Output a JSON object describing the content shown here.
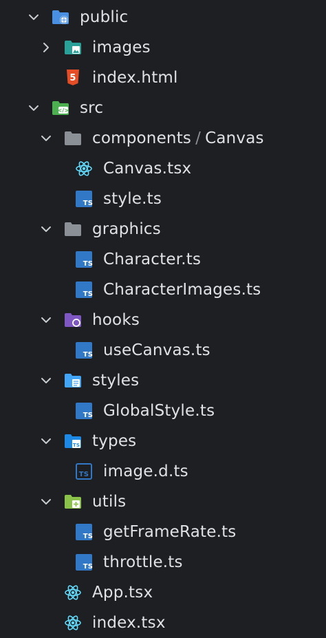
{
  "tree": [
    {
      "label": "public",
      "depth": 0,
      "expanded": true,
      "icon": "folder-public-icon"
    },
    {
      "label": "images",
      "depth": 1,
      "expanded": false,
      "icon": "folder-images-icon"
    },
    {
      "label": "index.html",
      "depth": 1,
      "icon": "html5-icon"
    },
    {
      "label": "src",
      "depth": 0,
      "expanded": true,
      "icon": "folder-src-icon"
    },
    {
      "label": "components",
      "label2": "Canvas",
      "separator": "/",
      "depth": 1,
      "expanded": true,
      "icon": "folder-icon"
    },
    {
      "label": "Canvas.tsx",
      "depth": 2,
      "icon": "react-icon"
    },
    {
      "label": "style.ts",
      "depth": 2,
      "icon": "typescript-icon"
    },
    {
      "label": "graphics",
      "depth": 1,
      "expanded": true,
      "icon": "folder-icon"
    },
    {
      "label": "Character.ts",
      "depth": 2,
      "icon": "typescript-icon"
    },
    {
      "label": "CharacterImages.ts",
      "depth": 2,
      "icon": "typescript-icon"
    },
    {
      "label": "hooks",
      "depth": 1,
      "expanded": true,
      "icon": "folder-hooks-icon"
    },
    {
      "label": "useCanvas.ts",
      "depth": 2,
      "icon": "typescript-icon"
    },
    {
      "label": "styles",
      "depth": 1,
      "expanded": true,
      "icon": "folder-styles-icon"
    },
    {
      "label": "GlobalStyle.ts",
      "depth": 2,
      "icon": "typescript-icon"
    },
    {
      "label": "types",
      "depth": 1,
      "expanded": true,
      "icon": "folder-types-icon"
    },
    {
      "label": "image.d.ts",
      "depth": 2,
      "icon": "typescript-def-icon"
    },
    {
      "label": "utils",
      "depth": 1,
      "expanded": true,
      "icon": "folder-utils-icon"
    },
    {
      "label": "getFrameRate.ts",
      "depth": 2,
      "icon": "typescript-icon"
    },
    {
      "label": "throttle.ts",
      "depth": 2,
      "icon": "typescript-icon"
    },
    {
      "label": "App.tsx",
      "depth": 1,
      "icon": "react-icon"
    },
    {
      "label": "index.tsx",
      "depth": 1,
      "icon": "react-icon"
    }
  ],
  "colors": {
    "background": "#1e1f22",
    "text": "#dfe1e5",
    "chevron": "#c8cbd0",
    "typescript": "#3178c6",
    "react": "#61dafb",
    "html5": "#e44d26",
    "folder_gray": "#8b8f96",
    "folder_public": "#4a90e2",
    "folder_images": "#2aa198",
    "folder_src": "#4caf50",
    "folder_hooks": "#7e57c2",
    "folder_styles": "#42a5f5",
    "folder_types": "#1e88e5",
    "folder_utils": "#8bc34a"
  }
}
